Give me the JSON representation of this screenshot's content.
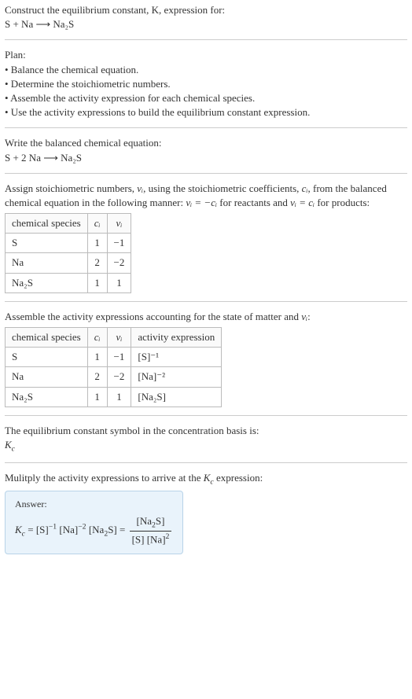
{
  "construct_line": "Construct the equilibrium constant, K, expression for:",
  "eq_unbalanced": "S + Na  ⟶  Na₂S",
  "plan_header": "Plan:",
  "plan_b1": "• Balance the chemical equation.",
  "plan_b2": "• Determine the stoichiometric numbers.",
  "plan_b3": "• Assemble the activity expression for each chemical species.",
  "plan_b4": "• Use the activity expressions to build the equilibrium constant expression.",
  "write_balanced": "Write the balanced chemical equation:",
  "eq_balanced": "S + 2 Na  ⟶  Na₂S",
  "assign_text_a": "Assign stoichiometric numbers, ",
  "assign_text_b": ", using the stoichiometric coefficients, ",
  "assign_text_c": ", from the balanced chemical equation in the following manner: ",
  "assign_text_d": " for reactants and ",
  "assign_text_e": " for products:",
  "nu_i": "νᵢ",
  "c_i": "cᵢ",
  "rel_reactants": "νᵢ = −cᵢ",
  "rel_products": "νᵢ = cᵢ",
  "chart_data": {
    "table1": {
      "type": "table",
      "columns": [
        "chemical species",
        "cᵢ",
        "νᵢ"
      ],
      "rows": [
        [
          "S",
          "1",
          "−1"
        ],
        [
          "Na",
          "2",
          "−2"
        ],
        [
          "Na₂S",
          "1",
          "1"
        ]
      ]
    },
    "table2": {
      "type": "table",
      "columns": [
        "chemical species",
        "cᵢ",
        "νᵢ",
        "activity expression"
      ],
      "rows": [
        [
          "S",
          "1",
          "−1",
          "[S]⁻¹"
        ],
        [
          "Na",
          "2",
          "−2",
          "[Na]⁻²"
        ],
        [
          "Na₂S",
          "1",
          "1",
          "[Na₂S]"
        ]
      ]
    }
  },
  "assemble_text_a": "Assemble the activity expressions accounting for the state of matter and ",
  "assemble_text_b": ":",
  "kc_symbol_text": "The equilibrium constant symbol in the concentration basis is:",
  "kc": "K_c",
  "multiply_text_a": "Mulitply the activity expressions to arrive at the ",
  "multiply_text_b": " expression:",
  "answer_label": "Answer:",
  "answer_lhs_pre": "K_c = [S]",
  "answer_exp1": "−1",
  "answer_mid1": " [Na]",
  "answer_exp2": "−2",
  "answer_mid2": " [Na₂S] = ",
  "answer_num": "[Na₂S]",
  "answer_den": "[S] [Na]²"
}
